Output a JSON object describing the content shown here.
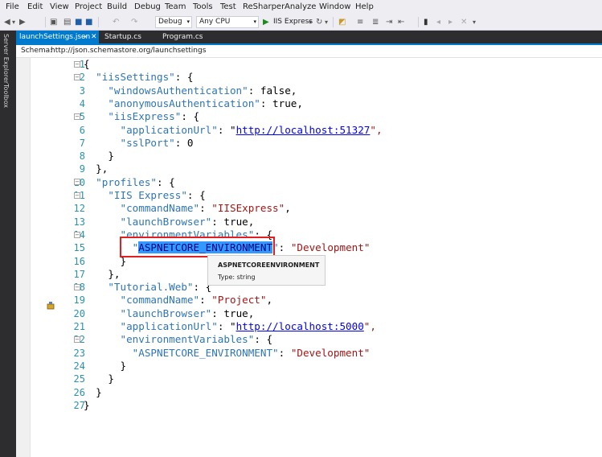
{
  "menu": [
    "File",
    "Edit",
    "View",
    "Project",
    "Build",
    "Debug",
    "Team",
    "Tools",
    "Test",
    "ReSharper",
    "Analyze",
    "Window",
    "Help"
  ],
  "toolbar": {
    "config": "Debug",
    "platform": "Any CPU",
    "run": "IIS Express"
  },
  "sidebar": {
    "server_explorer": "Server Explorer",
    "toolbox": "Toolbox"
  },
  "tabs": [
    {
      "label": "launchSettings.json"
    },
    {
      "label": "Startup.cs"
    },
    {
      "label": "Program.cs"
    }
  ],
  "schema": {
    "label": "Schema:",
    "url": "http://json.schemastore.org/launchsettings"
  },
  "line_numbers": [
    "1",
    "2",
    "3",
    "4",
    "5",
    "6",
    "7",
    "8",
    "9",
    "10",
    "11",
    "12",
    "13",
    "14",
    "15",
    "16",
    "17",
    "18",
    "19",
    "20",
    "21",
    "22",
    "23",
    "24",
    "25",
    "26",
    "27"
  ],
  "code": {
    "l1": "{",
    "l2a": "  \"iisSettings\"",
    "l2b": ": {",
    "l3a": "    \"windowsAuthentication\"",
    "l3b": ": false,",
    "l4a": "    \"anonymousAuthentication\"",
    "l4b": ": true,",
    "l5a": "    \"iisExpress\"",
    "l5b": ": {",
    "l6a": "      \"applicationUrl\"",
    "l6b": ": \"",
    "l6url": "http://localhost:51327",
    "l6c": "\",",
    "l7a": "      \"sslPort\"",
    "l7b": ": 0",
    "l8": "    }",
    "l9": "  },",
    "l10a": "  \"profiles\"",
    "l10b": ": {",
    "l11a": "    \"IIS Express\"",
    "l11b": ": {",
    "l12a": "      \"commandName\"",
    "l12b": ": ",
    "l12c": "\"IISExpress\"",
    "l12d": ",",
    "l13a": "      \"launchBrowser\"",
    "l13b": ": true,",
    "l14a": "      \"environmentVariables\"",
    "l14b": ": {",
    "l15a": "        \"",
    "l15sel": "ASPNETCORE_ENVIRONMENT",
    "l15b": "\"",
    ": ": "",
    "l15c": ": ",
    "l15d": "\"Development\"",
    "l16": "      }",
    "l17": "    },",
    "l18a": "    \"Tutorial.Web\"",
    "l18b": ": {",
    "l19a": "      \"commandName\"",
    "l19b": ": ",
    "l19c": "\"Project\"",
    "l19d": ",",
    "l20a": "      \"launchBrowser\"",
    "l20b": ": true,",
    "l21a": "      \"applicationUrl\"",
    "l21b": ": \"",
    "l21url": "http://localhost:5000",
    "l21c": "\",",
    "l22a": "      \"environmentVariables\"",
    "l22b": ": {",
    "l23a": "        \"ASPNETCORE_ENVIRONMENT\"",
    "l23b": ": ",
    "l23c": "\"Development\"",
    "l24": "      }",
    "l25": "    }",
    "l26": "  }",
    "l27": "}"
  },
  "tooltip": {
    "title": "ASPNETCOREENVIRONMENT",
    "type": "Type:  string"
  }
}
